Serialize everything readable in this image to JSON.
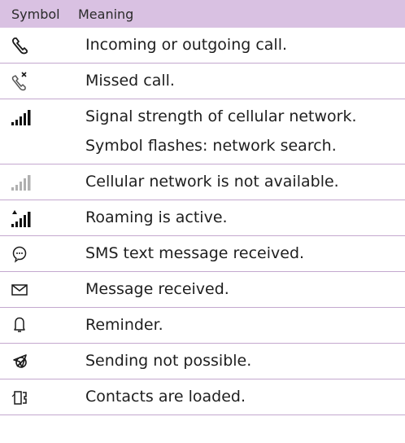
{
  "table": {
    "headers": {
      "symbol": "Symbol",
      "meaning": "Meaning"
    },
    "rows": [
      {
        "icon": "phone-handset-icon",
        "meaning": "Incoming or outgoing call."
      },
      {
        "icon": "missed-call-icon",
        "meaning": "Missed call."
      },
      {
        "icon": "signal-strength-icon",
        "meaning": "Signal strength of cellular network.",
        "meaning2": "Symbol flashes: network search."
      },
      {
        "icon": "signal-unavailable-icon",
        "meaning": "Cellular network is not available."
      },
      {
        "icon": "roaming-signal-icon",
        "meaning": "Roaming is active."
      },
      {
        "icon": "sms-bubble-icon",
        "meaning": "SMS text message received."
      },
      {
        "icon": "envelope-icon",
        "meaning": "Message received."
      },
      {
        "icon": "bell-icon",
        "meaning": "Reminder."
      },
      {
        "icon": "sending-blocked-icon",
        "meaning": "Sending not possible."
      },
      {
        "icon": "contacts-sim-icon",
        "meaning": "Contacts are loaded."
      }
    ]
  }
}
